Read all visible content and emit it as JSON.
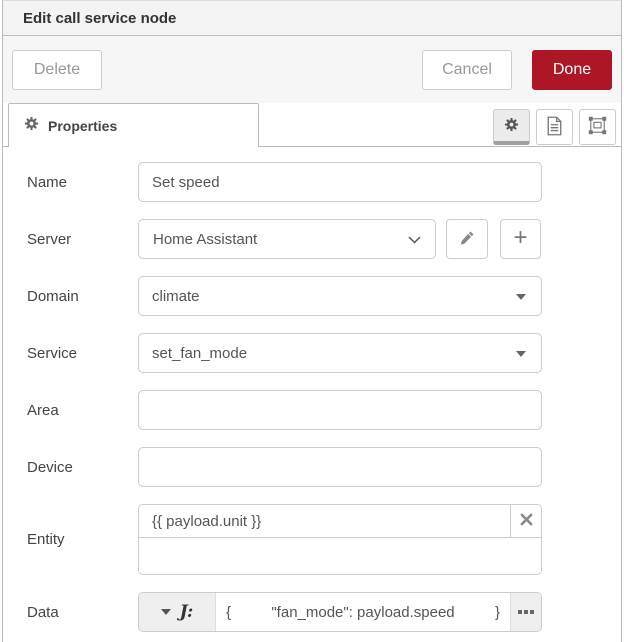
{
  "header": {
    "title": "Edit call service node"
  },
  "toolbar": {
    "delete_label": "Delete",
    "cancel_label": "Cancel",
    "done_label": "Done"
  },
  "tabs": {
    "properties_label": "Properties",
    "icon_buttons": [
      "gear-icon",
      "document-icon",
      "appearance-icon"
    ]
  },
  "form": {
    "name": {
      "label": "Name",
      "value": "Set speed"
    },
    "server": {
      "label": "Server",
      "value": "Home Assistant"
    },
    "domain": {
      "label": "Domain",
      "value": "climate"
    },
    "service": {
      "label": "Service",
      "value": "set_fan_mode"
    },
    "area": {
      "label": "Area",
      "value": ""
    },
    "device": {
      "label": "Device",
      "value": ""
    },
    "entity": {
      "label": "Entity",
      "value": "{{ payload.unit }}",
      "new_value": ""
    },
    "data": {
      "label": "Data",
      "type_glyph": "J:",
      "open_brace": "{",
      "expression": "\"fan_mode\": payload.speed",
      "close_brace": "}"
    }
  },
  "colors": {
    "accent_red": "#AD1625",
    "header_bg": "#f3f3f3",
    "selected_tab_btn_bg": "#ececec"
  }
}
